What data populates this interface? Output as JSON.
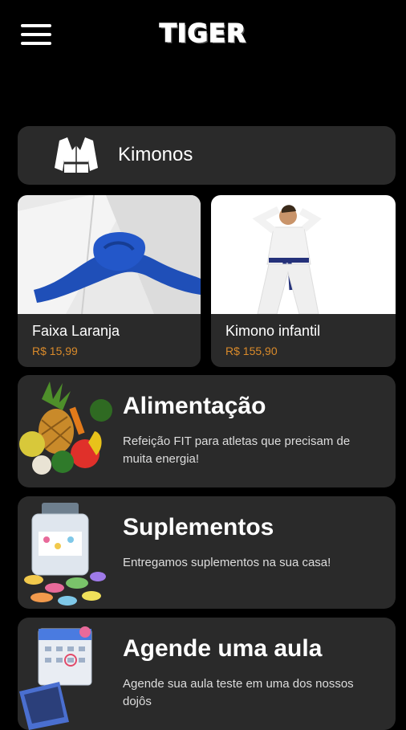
{
  "header": {
    "logo": "TIGER",
    "menu_icon": "hamburger-icon"
  },
  "category": {
    "label": "Kimonos",
    "icon": "kimono-icon"
  },
  "products": [
    {
      "name": "Faixa Laranja",
      "price": "R$ 15,99"
    },
    {
      "name": "Kimono infantil",
      "price": "R$ 155,90"
    }
  ],
  "features": [
    {
      "title": "Alimentação",
      "description": "Refeição FIT para atletas que precisam de muita energia!"
    },
    {
      "title": "Suplementos",
      "description": "Entregamos suplementos na sua casa!"
    },
    {
      "title": "Agende uma aula",
      "description": "Agende sua aula teste em uma dos nossos dojôs"
    }
  ],
  "colors": {
    "background": "#000000",
    "card": "#2a2a2a",
    "price": "#d98a2a"
  }
}
